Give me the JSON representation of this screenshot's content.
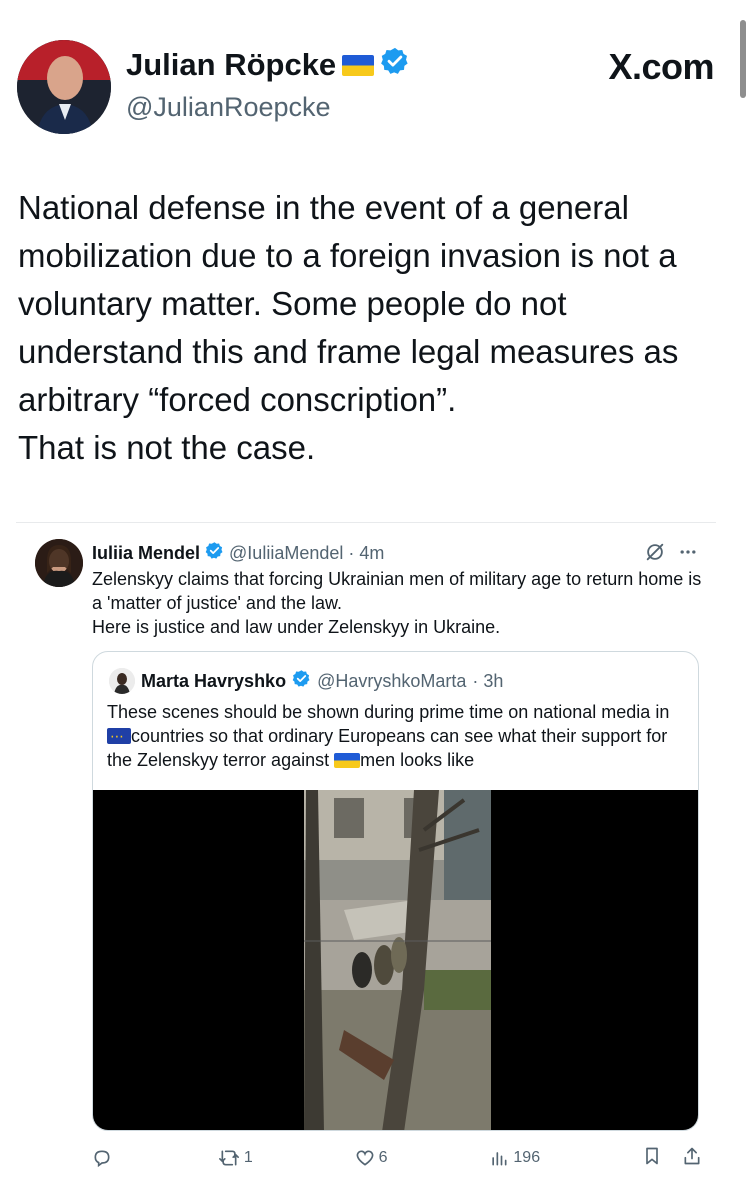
{
  "header": {
    "author_name": "Julian Röpcke",
    "author_handle": "@JulianRoepcke",
    "site_label": "X.com",
    "verified_icon": "verified-badge-icon",
    "flag_icon": "ukraine-flag-icon"
  },
  "tweet": {
    "text": "National defense in the event of a general mobilization due to a foreign invasion is not a voluntary matter. Some people do not understand this and frame legal measures as arbitrary “forced conscription”.\nThat is not the case."
  },
  "embedded": {
    "name": "Iuliia Mendel",
    "handle": "@IuliiaMendel",
    "time": "· 4m",
    "text": "Zelenskyy claims that forcing Ukrainian men of military age to return home is a 'matter of justice' and the law.\nHere is justice and law under Zelenskyy in Ukraine.",
    "quote": {
      "name": "Marta Havryshko",
      "handle": "@HavryshkoMarta",
      "time": "· 3h",
      "text_part1": "These scenes should be shown during prime time on national media in ",
      "text_part2": "countries so that ordinary Europeans can see what their support for the Zelenskyy terror against ",
      "text_part3": "men looks like"
    },
    "actions": {
      "replies": "",
      "reposts": "1",
      "likes": "6",
      "views": "196"
    }
  },
  "colors": {
    "text": "#0f1419",
    "secondary": "#536471",
    "verified_blue": "#1d9bf0",
    "border": "#cfd9de"
  }
}
